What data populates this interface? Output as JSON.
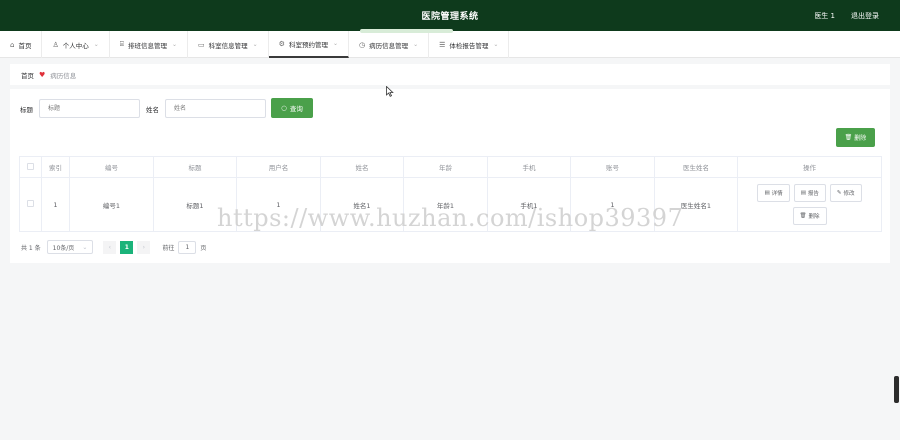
{
  "header": {
    "title": "医院管理系统",
    "user": "医生 1",
    "logout": "退出登录"
  },
  "nav": {
    "items": [
      {
        "label": "首页",
        "icon": "home-icon"
      },
      {
        "label": "个人中心",
        "icon": "user-icon"
      },
      {
        "label": "排班信息管理",
        "icon": "building-icon"
      },
      {
        "label": "科室信息管理",
        "icon": "chat-icon"
      },
      {
        "label": "科室预约管理",
        "icon": "gear-icon"
      },
      {
        "label": "病历信息管理",
        "icon": "clock-icon"
      },
      {
        "label": "体检报告管理",
        "icon": "list-icon"
      }
    ],
    "active": "科室预约管理"
  },
  "breadcrumb": {
    "home": "首页",
    "current": "病历信息"
  },
  "search": {
    "title_label": "标题",
    "title_placeholder": "标题",
    "name_label": "姓名",
    "name_placeholder": "姓名",
    "button": "查询"
  },
  "toolbar": {
    "delete": "删除"
  },
  "table": {
    "headers": [
      "索引",
      "编号",
      "标题",
      "用户名",
      "姓名",
      "年龄",
      "手机",
      "账号",
      "医生姓名",
      "操作"
    ],
    "rows": [
      {
        "index": "1",
        "code": "编号1",
        "title": "标题1",
        "username": "1",
        "name": "姓名1",
        "age": "年龄1",
        "phone": "手机1",
        "account": "1",
        "doctor": "医生姓名1",
        "actions": {
          "detail": "详情",
          "report": "报告",
          "edit": "修改",
          "delete": "删除"
        }
      }
    ]
  },
  "pagination": {
    "total": "共 1 条",
    "page_size": "10条/页",
    "current_page": "1",
    "goto_label": "前往",
    "goto_value": "1",
    "page_unit": "页"
  },
  "watermark": "https://www.huzhan.com/ishop39397",
  "colors": {
    "topbar": "#0e3a1c",
    "primary_button": "#4aa04a",
    "active_page": "#1ab37a",
    "heart": "#e0303a"
  }
}
